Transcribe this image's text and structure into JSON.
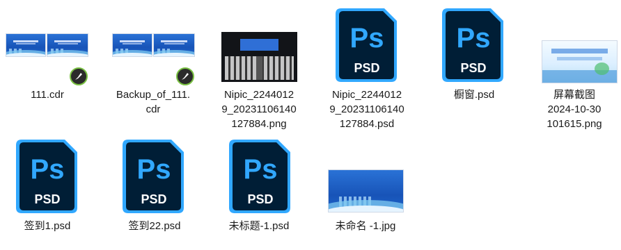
{
  "files": [
    {
      "name": "111.cdr",
      "icon": "cdr-thumbnail"
    },
    {
      "name": "Backup_of_111.\ncdr",
      "icon": "cdr-thumbnail"
    },
    {
      "name": "Nipic_2244012\n9_20231106140\n127884.png",
      "icon": "png-thumbnail"
    },
    {
      "name": "Nipic_2244012\n9_20231106140\n127884.psd",
      "icon": "psd-icon"
    },
    {
      "name": "橱窗.psd",
      "icon": "psd-icon"
    },
    {
      "name": "屏幕截图\n2024-10-30\n101615.png",
      "icon": "png-thumbnail"
    },
    {
      "name": "签到1.psd",
      "icon": "psd-icon"
    },
    {
      "name": "签到22.psd",
      "icon": "psd-icon"
    },
    {
      "name": "未标题-1.psd",
      "icon": "psd-icon"
    },
    {
      "name": "未命名 -1.jpg",
      "icon": "jpg-thumbnail"
    }
  ],
  "psd_icon": {
    "glyph": "Ps",
    "caption": "PSD",
    "color_dark": "#001e36",
    "color_accent": "#31a8ff"
  },
  "colors": {
    "background": "#ffffff",
    "banner_blue": "#1854b8",
    "cdr_green": "#7ac143"
  }
}
